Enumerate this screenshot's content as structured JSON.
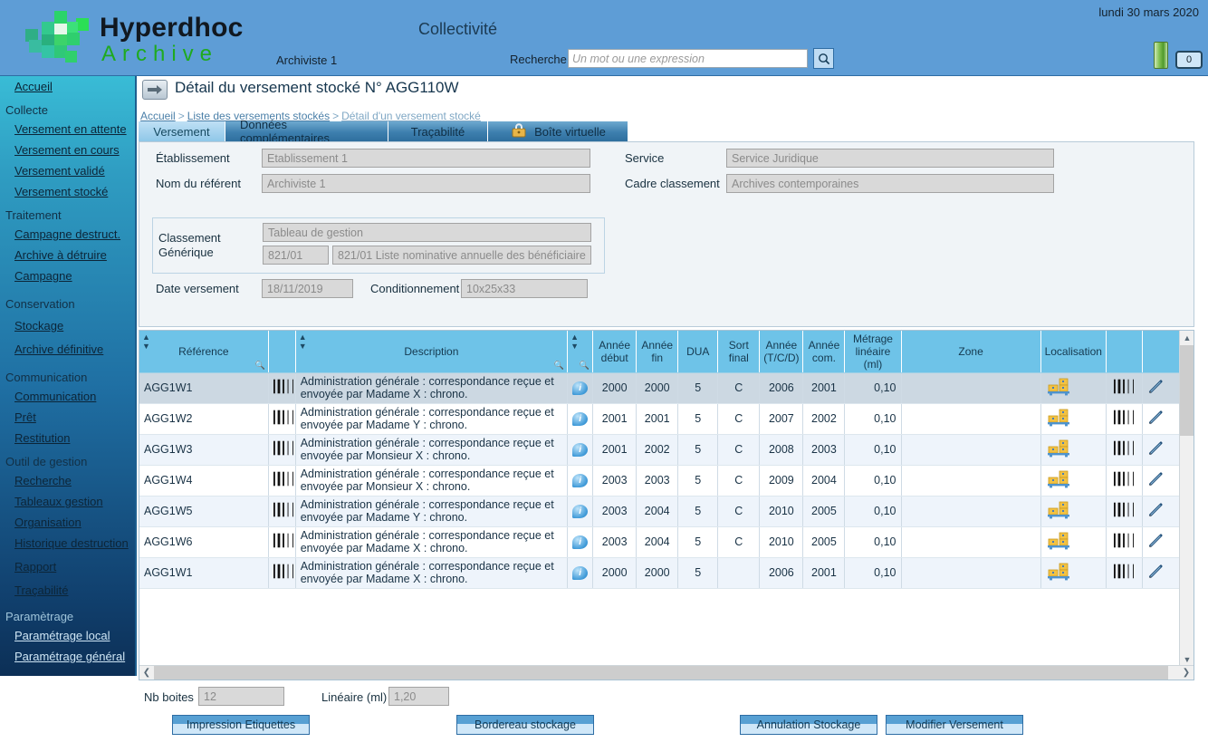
{
  "header": {
    "brand_primary": "Hyperdhoc",
    "brand_secondary": "Archive",
    "archivist": "Archiviste 1",
    "collectivity": "Collectivité",
    "date": "lundi 30 mars 2020",
    "search_label": "Recherche",
    "search_placeholder": "Un mot ou une expression",
    "search_value": "",
    "counter": "0",
    "icons": {
      "search": "search-icon",
      "battery": "battery-icon"
    },
    "colors": {
      "header_bg": "#5e9dd6",
      "brand_green": "#1faa1f",
      "accent": "#6ec3e8"
    }
  },
  "sidebar": {
    "items": [
      {
        "label": "Accueil",
        "type": "link",
        "tone": "light"
      },
      {
        "label": "Collecte",
        "type": "group"
      },
      {
        "label": "Versement en attente",
        "type": "link"
      },
      {
        "label": "Versement en cours",
        "type": "link"
      },
      {
        "label": "Versement validé",
        "type": "link"
      },
      {
        "label": "Versement stocké",
        "type": "link"
      },
      {
        "label": "Traitement",
        "type": "group"
      },
      {
        "label": "Campagne destruct.",
        "type": "link"
      },
      {
        "label": "Archive à détruire",
        "type": "link"
      },
      {
        "label": "Campagne",
        "type": "link"
      },
      {
        "label": "Conservation",
        "type": "group"
      },
      {
        "label": "Stockage",
        "type": "link"
      },
      {
        "label": "Archive définitive",
        "type": "link"
      },
      {
        "label": "Communication",
        "type": "group"
      },
      {
        "label": "Communication",
        "type": "link"
      },
      {
        "label": "Prêt",
        "type": "link"
      },
      {
        "label": "Restitution",
        "type": "link"
      },
      {
        "label": "Outil de gestion",
        "type": "group"
      },
      {
        "label": "Recherche",
        "type": "link"
      },
      {
        "label": "Tableaux gestion",
        "type": "link"
      },
      {
        "label": "Organisation",
        "type": "link"
      },
      {
        "label": "Historique destruction",
        "type": "link"
      },
      {
        "label": "Rapport",
        "type": "link"
      },
      {
        "label": "Traçabilité",
        "type": "link"
      },
      {
        "label": "Paramètrage",
        "type": "group",
        "tone": "pale"
      },
      {
        "label": "Paramétrage local",
        "type": "link",
        "tone": "pale"
      },
      {
        "label": "Paramétrage général",
        "type": "link",
        "tone": "pale"
      }
    ]
  },
  "page": {
    "title": "Détail du versement stocké N° AGG110W",
    "back_icon": "back-icon",
    "breadcrumb": [
      {
        "label": "Accueil",
        "link": true
      },
      {
        "label": "Liste des versements stockés",
        "link": true
      },
      {
        "label": "Détail d'un versement stocké",
        "link": false
      }
    ],
    "breadcrumb_separator": ">"
  },
  "tabs": [
    {
      "label": "Versement",
      "active": true,
      "icon": null
    },
    {
      "label": "Données complémentaires",
      "active": false,
      "icon": null
    },
    {
      "label": "Traçabilité",
      "active": false,
      "icon": null
    },
    {
      "label": "Boîte virtuelle",
      "active": false,
      "icon": "lock-icon"
    }
  ],
  "form": {
    "etablissement": {
      "label": "Établissement",
      "value": "Etablissement 1"
    },
    "nom_referent": {
      "label": "Nom du référent",
      "value": "Archiviste 1"
    },
    "service": {
      "label": "Service",
      "value": "Service Juridique"
    },
    "cadre_classement": {
      "label": "Cadre classement",
      "value": "Archives contemporaines"
    },
    "classement_generique": {
      "label": "Classement Générique",
      "label_line1": "Classement",
      "label_line2": "Générique",
      "value": "Tableau de gestion",
      "code": "821/01",
      "detail": "821/01 Liste nominative annuelle des bénéficiaire"
    },
    "date_versement": {
      "label": "Date versement",
      "value": "18/11/2019"
    },
    "conditionnement": {
      "label": "Conditionnement",
      "value": "10x25x33"
    }
  },
  "table": {
    "columns": [
      {
        "label": "Référence",
        "sortable": true,
        "searchable": true
      },
      {
        "label": "",
        "sortable": false,
        "searchable": false
      },
      {
        "label": "Description",
        "sortable": true,
        "searchable": true
      },
      {
        "label": "",
        "sortable": true,
        "searchable": true
      },
      {
        "label": "Année début",
        "line1": "Année",
        "line2": "début"
      },
      {
        "label": "Année fin",
        "line1": "Année",
        "line2": "fin"
      },
      {
        "label": "DUA"
      },
      {
        "label": "Sort final",
        "line1": "Sort",
        "line2": "final"
      },
      {
        "label": "Année (T/C/D)",
        "line1": "Année",
        "line2": "(T/C/D)"
      },
      {
        "label": "Année com.",
        "line1": "Année",
        "line2": "com."
      },
      {
        "label": "Métrage linéaire (ml)",
        "line1": "Métrage",
        "line2": "linéaire",
        "line3": "(ml)"
      },
      {
        "label": "Zone"
      },
      {
        "label": "Localisation"
      },
      {
        "label": ""
      },
      {
        "label": ""
      }
    ],
    "rows": [
      {
        "reference": "AGG1W1",
        "description": "Administration générale : correspondance reçue et envoyée par Madame X : chrono.",
        "annee_debut": "2000",
        "annee_fin": "2000",
        "dua": "5",
        "sort_final": "C",
        "annee_tcd": "2006",
        "annee_com": "2001",
        "metrage": "0,10",
        "zone": "",
        "localisation": "pallet-icon",
        "selected": true
      },
      {
        "reference": "AGG1W2",
        "description": "Administration générale : correspondance reçue et envoyée par Madame Y : chrono.",
        "annee_debut": "2001",
        "annee_fin": "2001",
        "dua": "5",
        "sort_final": "C",
        "annee_tcd": "2007",
        "annee_com": "2002",
        "metrage": "0,10",
        "zone": "",
        "localisation": "pallet-icon",
        "selected": false
      },
      {
        "reference": "AGG1W3",
        "description": "Administration générale : correspondance reçue et envoyée par Monsieur X : chrono.",
        "annee_debut": "2001",
        "annee_fin": "2002",
        "dua": "5",
        "sort_final": "C",
        "annee_tcd": "2008",
        "annee_com": "2003",
        "metrage": "0,10",
        "zone": "",
        "localisation": "pallet-icon",
        "selected": false
      },
      {
        "reference": "AGG1W4",
        "description": "Administration générale : correspondance reçue et envoyée par Monsieur X : chrono.",
        "annee_debut": "2003",
        "annee_fin": "2003",
        "dua": "5",
        "sort_final": "C",
        "annee_tcd": "2009",
        "annee_com": "2004",
        "metrage": "0,10",
        "zone": "",
        "localisation": "pallet-icon",
        "selected": false
      },
      {
        "reference": "AGG1W5",
        "description": "Administration générale : correspondance reçue et envoyée par Madame Y : chrono.",
        "annee_debut": "2003",
        "annee_fin": "2004",
        "dua": "5",
        "sort_final": "C",
        "annee_tcd": "2010",
        "annee_com": "2005",
        "metrage": "0,10",
        "zone": "",
        "localisation": "pallet-icon",
        "selected": false
      },
      {
        "reference": "AGG1W6",
        "description": "Administration générale : correspondance reçue et envoyée par Madame X : chrono.",
        "annee_debut": "2003",
        "annee_fin": "2004",
        "dua": "5",
        "sort_final": "C",
        "annee_tcd": "2010",
        "annee_com": "2005",
        "metrage": "0,10",
        "zone": "",
        "localisation": "pallet-icon",
        "selected": false
      },
      {
        "reference": "AGG1W1",
        "description": "Administration générale : correspondance reçue et envoyée par Madame X : chrono.",
        "annee_debut": "2000",
        "annee_fin": "2000",
        "dua": "5",
        "sort_final": "",
        "annee_tcd": "2006",
        "annee_com": "2001",
        "metrage": "0,10",
        "zone": "",
        "localisation": "pallet-icon",
        "selected": false
      }
    ]
  },
  "footer": {
    "nb_boites_label": "Nb boites",
    "nb_boites_value": "12",
    "lineaire_label": "Linéaire (ml)",
    "lineaire_value": "1,20",
    "buttons": {
      "impression": "Impression Etiquettes",
      "bordereau": "Bordereau stockage",
      "annulation": "Annulation Stockage",
      "modifier": "Modifier Versement"
    }
  }
}
